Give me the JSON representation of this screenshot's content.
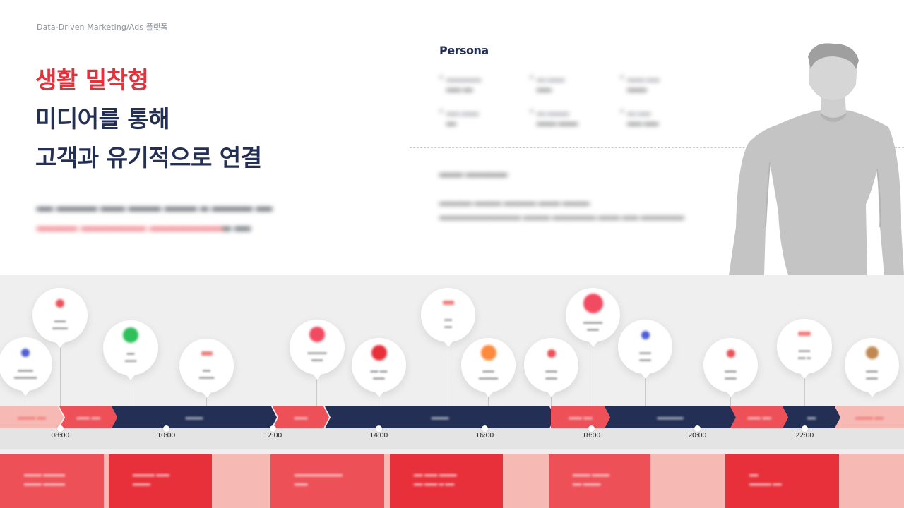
{
  "header": {
    "tagline": "Data-Driven Marketing/Ads 플랫폼",
    "headline": {
      "line1": "생활 밀착형",
      "line2": "미디어를 통해",
      "line3": "고객과 유기적으로 연결"
    }
  },
  "persona": {
    "title": "Persona"
  },
  "timeline": {
    "ticks": [
      "08:00",
      "10:00",
      "12:00",
      "14:00",
      "16:00",
      "18:00",
      "20:00",
      "22:00"
    ]
  },
  "icons": {
    "bubble_icons": [
      "blue-dot-icon",
      "red-dot-icon",
      "green-dot-icon",
      "red-text-icon",
      "pink-dot-icon",
      "red-dot-icon",
      "red-text-icon",
      "orange-dot-icon",
      "red-dot-icon",
      "pink-dot-icon",
      "blue-dot-icon",
      "red-dot-icon",
      "red-text-icon",
      "brown-dot-icon"
    ]
  },
  "colors": {
    "navy": "#232f55",
    "red": "#e8303a",
    "red_medium": "#ee5058",
    "red_light": "#f6b9b3",
    "band_gray": "#efefef"
  }
}
